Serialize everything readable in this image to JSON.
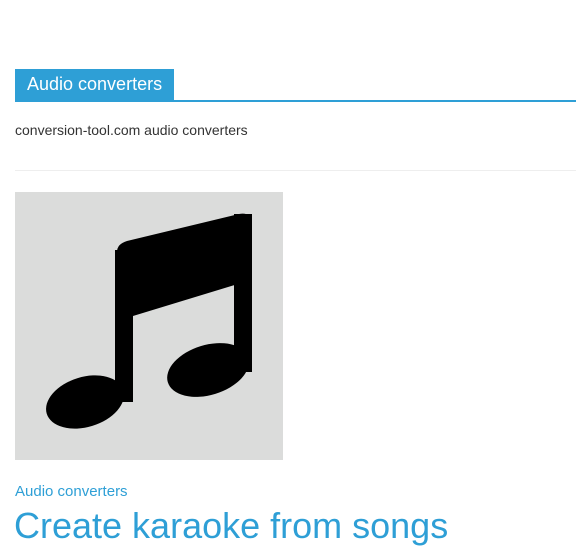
{
  "section": {
    "tab_label": "Audio converters",
    "description": "conversion-tool.com audio converters"
  },
  "article": {
    "image_icon": "music-note-icon",
    "category": "Audio converters",
    "title": "Create karaoke from songs"
  },
  "colors": {
    "accent": "#2e9fd6",
    "thumbnail_bg": "#dbdcdb",
    "text": "#333333"
  }
}
